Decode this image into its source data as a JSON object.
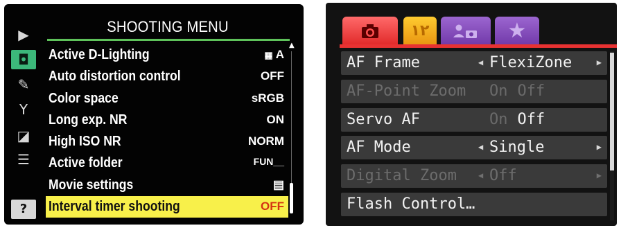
{
  "left_menu": {
    "title": "SHOOTING MENU",
    "sidebar_icons": [
      "playback-icon",
      "camera-icon",
      "pencil-icon",
      "wrench-icon",
      "retouch-icon",
      "my-menu-icon",
      "help-icon"
    ],
    "help_label": "?",
    "items": [
      {
        "label": "Active D-Lighting",
        "value": "ᵃ A"
      },
      {
        "label": "Auto distortion control",
        "value": "OFF"
      },
      {
        "label": "Color space",
        "value": "sRGB"
      },
      {
        "label": "Long exp. NR",
        "value": "ON"
      },
      {
        "label": "High ISO NR",
        "value": "NORM"
      },
      {
        "label": "Active folder",
        "value": "FUN__"
      },
      {
        "label": "Movie settings",
        "value": "▤"
      },
      {
        "label": "Interval timer shooting",
        "value": "OFF"
      }
    ],
    "selected_index": 7,
    "colors": {
      "selected_bg": "#f8f04a",
      "selected_value": "#d43412",
      "active_tab": "#3cb87a"
    }
  },
  "right_menu": {
    "tabs": [
      {
        "name": "camera-tab",
        "icon": "camera-icon"
      },
      {
        "name": "setup-tab",
        "icon": "wrench-icon"
      },
      {
        "name": "my-camera-tab",
        "icon": "person-camera-icon"
      },
      {
        "name": "my-menu-tab",
        "icon": "star-icon"
      }
    ],
    "items": [
      {
        "label": "AF Frame",
        "value": "FlexiZone",
        "state": "enabled",
        "arrows": true
      },
      {
        "label": "AF-Point Zoom",
        "on": "On",
        "off": "Off",
        "state": "dim"
      },
      {
        "label": "Servo AF",
        "on": "On",
        "off": "Off",
        "state": "enabled"
      },
      {
        "label": "AF Mode",
        "value": "Single",
        "state": "enabled",
        "arrows": true
      },
      {
        "label": "Digital Zoom",
        "value": "Off",
        "state": "dim",
        "arrows": true
      },
      {
        "label": "Flash Control…",
        "state": "enabled"
      }
    ],
    "colors": {
      "active_tab": "#e83232",
      "setup_tab": "#f0a418",
      "my_tabs": "#8a50c0"
    }
  }
}
